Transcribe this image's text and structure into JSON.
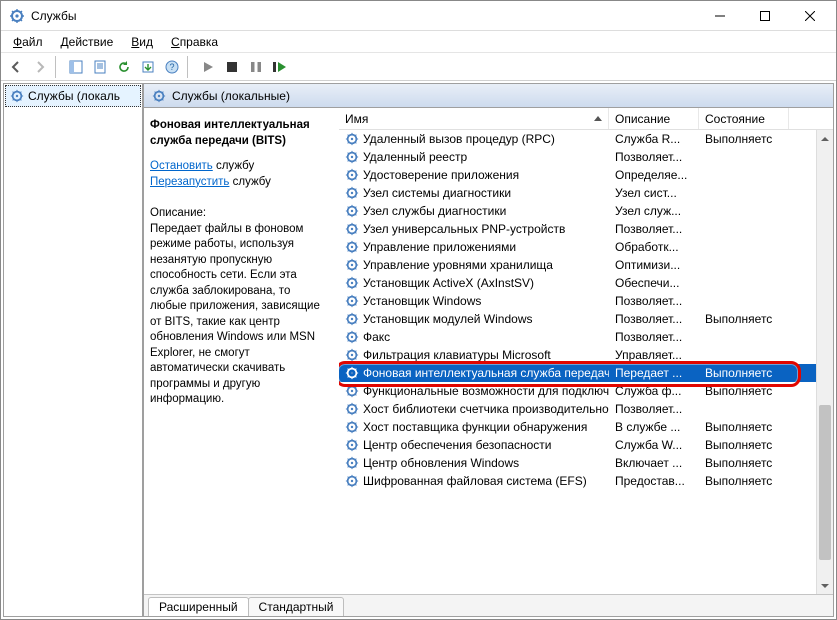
{
  "window": {
    "title": "Службы"
  },
  "menu": {
    "file": "Файл",
    "action": "Действие",
    "view": "Вид",
    "help": "Справка"
  },
  "tree": {
    "root": "Службы (локаль"
  },
  "panel": {
    "header": "Службы (локальные)"
  },
  "details": {
    "name": "Фоновая интеллектуальная служба передачи (BITS)",
    "stop_link": "Остановить",
    "stop_suffix": " службу",
    "restart_link": "Перезапустить",
    "restart_suffix": " службу",
    "desc_label": "Описание:",
    "desc_text": "Передает файлы в фоновом режиме работы, используя незанятую пропускную способность сети. Если эта служба заблокирована, то любые приложения, зависящие от BITS, такие как центр обновления Windows или MSN Explorer, не смогут автоматически скачивать программы и другую информацию."
  },
  "columns": {
    "name": "Имя",
    "desc": "Описание",
    "status": "Состояние"
  },
  "tabs": {
    "ext": "Расширенный",
    "std": "Стандартный"
  },
  "services": [
    {
      "name": "Удаленный вызов процедур (RPC)",
      "desc": "Служба R...",
      "status": "Выполняетс"
    },
    {
      "name": "Удаленный реестр",
      "desc": "Позволяет...",
      "status": ""
    },
    {
      "name": "Удостоверение приложения",
      "desc": "Определяе...",
      "status": ""
    },
    {
      "name": "Узел системы диагностики",
      "desc": "Узел сист...",
      "status": ""
    },
    {
      "name": "Узел службы диагностики",
      "desc": "Узел служ...",
      "status": ""
    },
    {
      "name": "Узел универсальных PNP-устройств",
      "desc": "Позволяет...",
      "status": ""
    },
    {
      "name": "Управление приложениями",
      "desc": "Обработк...",
      "status": ""
    },
    {
      "name": "Управление уровнями хранилища",
      "desc": "Оптимизи...",
      "status": ""
    },
    {
      "name": "Установщик ActiveX (AxInstSV)",
      "desc": "Обеспечи...",
      "status": ""
    },
    {
      "name": "Установщик Windows",
      "desc": "Позволяет...",
      "status": ""
    },
    {
      "name": "Установщик модулей Windows",
      "desc": "Позволяет...",
      "status": "Выполняетс"
    },
    {
      "name": "Факс",
      "desc": "Позволяет...",
      "status": ""
    },
    {
      "name": "Фильтрация клавиатуры Microsoft",
      "desc": "Управляет...",
      "status": ""
    },
    {
      "name": "Фоновая интеллектуальная служба передачи (...",
      "desc": "Передает ...",
      "status": "Выполняетс",
      "selected": true
    },
    {
      "name": "Функциональные возможности для подключе...",
      "desc": "Служба ф...",
      "status": "Выполняетс"
    },
    {
      "name": "Хост библиотеки счетчика производительност...",
      "desc": "Позволяет...",
      "status": ""
    },
    {
      "name": "Хост поставщика функции обнаружения",
      "desc": "В службе ...",
      "status": "Выполняетс"
    },
    {
      "name": "Центр обеспечения безопасности",
      "desc": "Служба W...",
      "status": "Выполняетс"
    },
    {
      "name": "Центр обновления Windows",
      "desc": "Включает ...",
      "status": "Выполняетс"
    },
    {
      "name": "Шифрованная файловая система (EFS)",
      "desc": "Предостав...",
      "status": "Выполняетс"
    }
  ]
}
